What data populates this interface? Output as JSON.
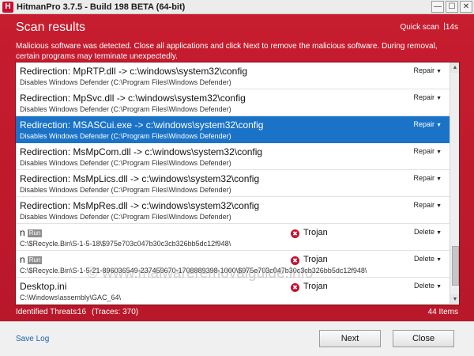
{
  "window": {
    "app_icon": "H",
    "title": "HitmanPro 3.7.5 - Build 198 BETA (64-bit)",
    "controls": {
      "minimize": "—",
      "maximize": "☐",
      "close": "✕"
    }
  },
  "colors": {
    "accent_red": "#c61d2f",
    "selection_blue": "#1b73c8",
    "link_blue": "#1a5fb4"
  },
  "header": {
    "title": "Scan results",
    "scan_type": "Quick scan",
    "separator": "|",
    "scan_time": "14s",
    "message": "Malicious software was detected. Close all applications and click Next to remove the malicious software. During removal, certain programs may terminate unexpectedly."
  },
  "results": [
    {
      "title": "Redirection: MpRTP.dll -> c:\\windows\\system32\\config",
      "subtitle": "Disables Windows Defender (C:\\Program Files\\Windows Defender)",
      "action": "Repair",
      "caret": "▼"
    },
    {
      "title": "Redirection: MpSvc.dll -> c:\\windows\\system32\\config",
      "subtitle": "Disables Windows Defender (C:\\Program Files\\Windows Defender)",
      "action": "Repair",
      "caret": "▼"
    },
    {
      "title": "Redirection: MSASCui.exe -> c:\\windows\\system32\\config",
      "subtitle": "Disables Windows Defender (C:\\Program Files\\Windows Defender)",
      "action": "Repair",
      "caret": "▼"
    },
    {
      "title": "Redirection: MsMpCom.dll -> c:\\windows\\system32\\config",
      "subtitle": "Disables Windows Defender (C:\\Program Files\\Windows Defender)",
      "action": "Repair",
      "caret": "▼"
    },
    {
      "title": "Redirection: MsMpLics.dll -> c:\\windows\\system32\\config",
      "subtitle": "Disables Windows Defender (C:\\Program Files\\Windows Defender)",
      "action": "Repair",
      "caret": "▼"
    },
    {
      "title": "Redirection: MsMpRes.dll -> c:\\windows\\system32\\config",
      "subtitle": "Disables Windows Defender (C:\\Program Files\\Windows Defender)",
      "action": "Repair",
      "caret": "▼"
    },
    {
      "title": "n",
      "badge": "Run",
      "subtitle": "C:\\$Recycle.Bin\\S-1-5-18\\$975e703c047b30c3cb326bb5dc12f948\\",
      "threat": "Trojan",
      "threat_icon": "✖",
      "action": "Delete",
      "caret": "▼"
    },
    {
      "title": "n",
      "badge": "Run",
      "subtitle": "C:\\$Recycle.Bin\\S-1-5-21-896036549-237459670-1708889398-1000\\$975e703c047b30c3cb326bb5dc12f948\\",
      "threat": "Trojan",
      "threat_icon": "✖",
      "action": "Delete",
      "caret": "▼"
    },
    {
      "title": "Desktop.ini",
      "subtitle": "C:\\Windows\\assembly\\GAC_64\\",
      "threat": "Trojan",
      "threat_icon": "✖",
      "action": "Delete",
      "caret": "▼"
    }
  ],
  "scrollbar": {
    "up_arrow": "▲",
    "down_arrow": "▼"
  },
  "watermark": {
    "list_text": "© www.malwareremovalguide.info",
    "panel_glyph": "H"
  },
  "status": {
    "identified_label": "Identified Threats:",
    "identified_count": "16",
    "traces": "(Traces: 370)",
    "items": "44 Items"
  },
  "footer": {
    "save_log": "Save Log",
    "next": "Next",
    "close": "Close"
  }
}
